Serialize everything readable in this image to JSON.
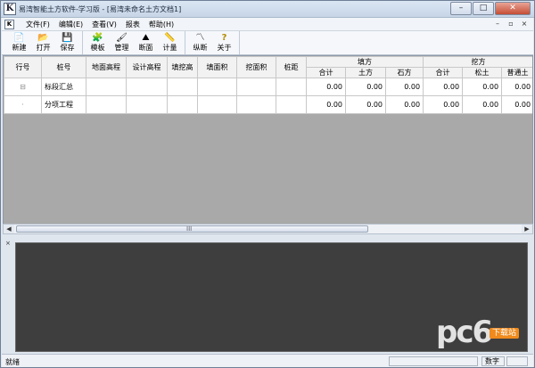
{
  "window": {
    "title": "易湾智能土方软件-学习版 - [易湾未命名土方文档1]",
    "app_icon_glyph": "K",
    "buttons": {
      "minimize": "–",
      "maximize": "□",
      "close": "✕"
    }
  },
  "menubar": {
    "doc_icon_glyph": "K",
    "items": [
      "文件(F)",
      "编辑(E)",
      "查看(V)",
      "报表",
      "帮助(H)"
    ],
    "mdi": {
      "minimize": "–",
      "restore": "▫",
      "close": "×"
    }
  },
  "toolbar": {
    "groups": [
      [
        {
          "label": "新建",
          "icon": "📄"
        },
        {
          "label": "打开",
          "icon": "📂"
        },
        {
          "label": "保存",
          "icon": "💾"
        }
      ],
      [
        {
          "label": "模板",
          "icon": "🧩"
        },
        {
          "label": "管理",
          "icon": "🖌"
        },
        {
          "label": "断面",
          "icon": "⛰"
        },
        {
          "label": "计量",
          "icon": "📏"
        }
      ],
      [
        {
          "label": "纵断",
          "icon": "〽"
        },
        {
          "label": "关于",
          "icon": "?"
        }
      ]
    ]
  },
  "grid": {
    "headers_top": [
      "行号",
      "桩号",
      "地面高程",
      "设计高程",
      "填挖高",
      "填面积",
      "挖面积",
      "桩距",
      "填方",
      "挖方"
    ],
    "headers_sub": [
      "合计",
      "土方",
      "石方",
      "合计",
      "松土",
      "普通土"
    ],
    "rows": [
      {
        "tree": "⊟",
        "name": "标段汇总",
        "values": [
          "0.00",
          "0.00",
          "0.00",
          "0.00",
          "0.00",
          "0.00"
        ]
      },
      {
        "tree": "·",
        "name": "分项工程",
        "values": [
          "0.00",
          "0.00",
          "0.00",
          "0.00",
          "0.00",
          "0.00"
        ]
      }
    ],
    "scroll_left": "◀",
    "scroll_right": "▶",
    "scroll_grip": "III"
  },
  "panel": {
    "close": "×"
  },
  "statusbar": {
    "text": "就绪",
    "pane_numlock": "数字"
  },
  "watermark": {
    "logo": "pc6",
    "tag": "下载站"
  }
}
